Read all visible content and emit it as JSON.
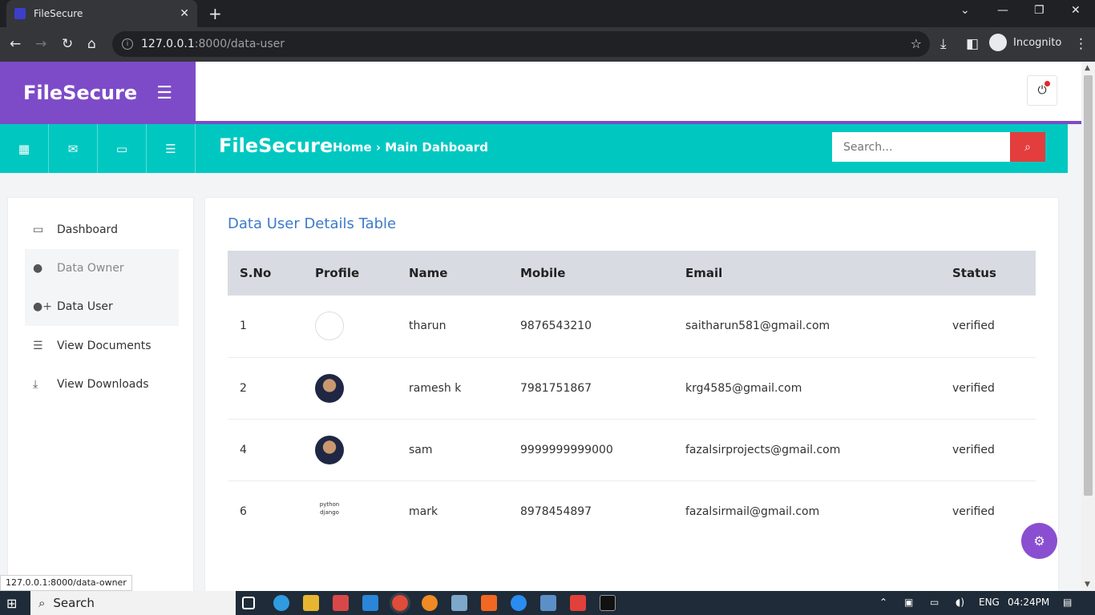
{
  "browser": {
    "tab_title": "FileSecure",
    "tab_close": "✕",
    "new_tab": "+",
    "url_host": "127.0.0.1",
    "url_path": ":8000/data-user",
    "incognito_label": "Incognito",
    "status_url": "127.0.0.1:8000/data-owner"
  },
  "app": {
    "brand": "FileSecure",
    "teal_brand": "FileSecure",
    "breadcrumb": "Home › Main Dahboard",
    "search_placeholder": "Search...",
    "accent_purple": "#7d4bc8",
    "accent_teal": "#00c8c1",
    "search_button_color": "#e33d3d"
  },
  "sidebar": {
    "items": [
      {
        "label": "Dashboard",
        "icon": "monitor-icon"
      },
      {
        "label": "Data Owner",
        "icon": "user-icon"
      },
      {
        "label": "Data User",
        "icon": "user-plus-icon"
      },
      {
        "label": "View Documents",
        "icon": "document-icon"
      },
      {
        "label": "View Downloads",
        "icon": "download-tray-icon"
      }
    ]
  },
  "main": {
    "title": "Data User Details Table",
    "columns": [
      "S.No",
      "Profile",
      "Name",
      "Mobile",
      "Email",
      "Status"
    ],
    "rows": [
      {
        "sno": "1",
        "profile": "broken-image",
        "name": "tharun",
        "mobile": "9876543210",
        "email": "saitharun581@gmail.com",
        "status": "verified"
      },
      {
        "sno": "2",
        "profile": "photo",
        "name": "ramesh k",
        "mobile": "7981751867",
        "email": "krg4585@gmail.com",
        "status": "verified"
      },
      {
        "sno": "4",
        "profile": "photo",
        "name": "sam",
        "mobile": "9999999999000",
        "email": "fazalsirprojects@gmail.com",
        "status": "verified"
      },
      {
        "sno": "6",
        "profile": "python-django-logo",
        "name": "mark",
        "mobile": "8978454897",
        "email": "fazalsirmail@gmail.com",
        "status": "verified"
      }
    ],
    "logo_text_top": "python",
    "logo_text_bottom": "django"
  },
  "taskbar": {
    "search_label": "Search",
    "language": "ENG",
    "time": "04:24PM"
  }
}
